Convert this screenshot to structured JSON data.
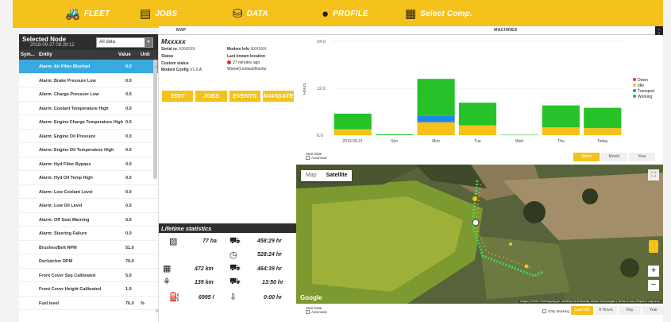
{
  "nav": [
    {
      "label": "FLEET",
      "icon": "truck-icon"
    },
    {
      "label": "JOBS",
      "icon": "document-icon"
    },
    {
      "label": "DATA",
      "icon": "database-icon"
    },
    {
      "label": "PROFILE",
      "icon": "person-icon"
    },
    {
      "label": "Select Comp.",
      "icon": "building-icon"
    }
  ],
  "left": {
    "title": "Selected Node",
    "date": "2019-09-27 08:28:12",
    "filter": "All data",
    "headers": {
      "sym": "Sym...",
      "entity": "Entity",
      "value": "Value",
      "unit": "Unit"
    },
    "rows": [
      {
        "name": "Alarm: Air Filter Blocked",
        "value": "0.0",
        "unit": ""
      },
      {
        "name": "Alarm: Brake Pressure Low",
        "value": "0.0",
        "unit": ""
      },
      {
        "name": "Alarm: Charge Pressure Low",
        "value": "0.0",
        "unit": ""
      },
      {
        "name": "Alarm: Coolant Temperature High",
        "value": "0.0",
        "unit": ""
      },
      {
        "name": "Alarm: Engine Charge Temperature High",
        "value": "0.0",
        "unit": ""
      },
      {
        "name": "Alarm: Engine Oil Pressure",
        "value": "0.0",
        "unit": ""
      },
      {
        "name": "Alarm: Engine Oil Temperature High",
        "value": "0.0",
        "unit": ""
      },
      {
        "name": "Alarm: Hyd Filter Bypass",
        "value": "0.0",
        "unit": ""
      },
      {
        "name": "Alarm: Hyd Oil Temp High",
        "value": "0.0",
        "unit": ""
      },
      {
        "name": "Alarm: Low Coolant Level",
        "value": "0.0",
        "unit": ""
      },
      {
        "name": "Alarm: Low Oil Level",
        "value": "0.0",
        "unit": ""
      },
      {
        "name": "Alarm: Off Seat Warning",
        "value": "0.0",
        "unit": ""
      },
      {
        "name": "Alarm: Steering Failure",
        "value": "0.0",
        "unit": ""
      },
      {
        "name": "Brushes/Belt RPM",
        "value": "51.0",
        "unit": ""
      },
      {
        "name": "Declutcher RPM",
        "value": "79.0",
        "unit": ""
      },
      {
        "name": "Front Cover Sep Calibrated",
        "value": "5.0",
        "unit": ""
      },
      {
        "name": "Front Cover Height Calibrated",
        "value": "1.0",
        "unit": ""
      },
      {
        "name": "Fuel level",
        "value": "76.0",
        "unit": "%"
      }
    ]
  },
  "tabs": {
    "map": "MAP",
    "machines": "MACHINES"
  },
  "details": {
    "name": "Mxxxxx",
    "serial_label": "Serial nr.",
    "serial_value": "XXXXXX",
    "modem_label": "Modem Info",
    "modem_value": "XXXXXX",
    "status_label": "Status",
    "custom_label": "Custom status",
    "config_label": "Modem Config",
    "config_value": "V1.0.A",
    "last_known_label": "Last known location",
    "last_known_time": "27 minutes ago",
    "last_known_loc": "Wartel(Lentwal)Ranfur",
    "buttons": {
      "edit": "EDIT",
      "jobs": "JOBS",
      "events": "EVENTS",
      "navigate": "NAVIGATE"
    }
  },
  "lifetime": {
    "title": "Lifetime statistics",
    "stats": [
      {
        "icon": "area-icon",
        "value": "77 ha"
      },
      {
        "icon": "engine-hours-icon",
        "value": "458:29 hr"
      },
      {
        "icon": "clock-icon",
        "value": "528:24 hr"
      },
      {
        "icon": "road-icon",
        "value": "472 km"
      },
      {
        "icon": "drive-hours-icon",
        "value": "464:39 hr"
      },
      {
        "icon": "field-icon",
        "value": "139 km"
      },
      {
        "icon": "idle-icon",
        "value": "13:50 hr"
      },
      {
        "icon": "fuel-icon",
        "value": "6995 l"
      },
      {
        "icon": "transport-icon",
        "value": "0:00 hr"
      }
    ]
  },
  "chart_data": {
    "type": "bar",
    "stacked": true,
    "categories": [
      "2019-09-21",
      "Sun",
      "Mon",
      "Tue",
      "Wed",
      "Thu",
      "Today"
    ],
    "ylabel": "Hours",
    "ylim": [
      0,
      24
    ],
    "yticks": [
      "0.0",
      "12.0",
      "24.0"
    ],
    "series": [
      {
        "name": "Down",
        "color": "#e53935",
        "values": [
          0,
          0,
          0,
          0,
          0,
          0,
          0
        ]
      },
      {
        "name": "Idle",
        "color": "#f4c21b",
        "values": [
          1.5,
          0,
          3.3,
          2.5,
          0,
          2.0,
          1.8
        ]
      },
      {
        "name": "Transport",
        "color": "#1e88e5",
        "values": [
          0,
          0,
          1.6,
          0,
          0,
          0,
          0
        ]
      },
      {
        "name": "Working",
        "color": "#27c12a",
        "values": [
          4.0,
          0.2,
          9.5,
          5.8,
          0.1,
          5.6,
          5.2
        ]
      }
    ],
    "legend": "right"
  },
  "chart_controls": {
    "start_date": "Start Date",
    "automatic": "Automatic",
    "ranges": [
      "Week",
      "Month",
      "Year"
    ],
    "active_range": "Week"
  },
  "map": {
    "type_map": "Map",
    "type_satellite": "Satellite",
    "google": "Google",
    "attribution": "Imagery ©2019, Getmapping plc, Infoterra Ltd & Bluesky, Maxar Technologies | Terms of Use | Report a map error"
  },
  "map_controls": {
    "start_date": "Start Date",
    "automatic": "Automatic",
    "only_working": "Only Working",
    "ranges": [
      "Last 500",
      "8 Hours",
      "Day",
      "Year"
    ],
    "active_range": "Last 500"
  }
}
